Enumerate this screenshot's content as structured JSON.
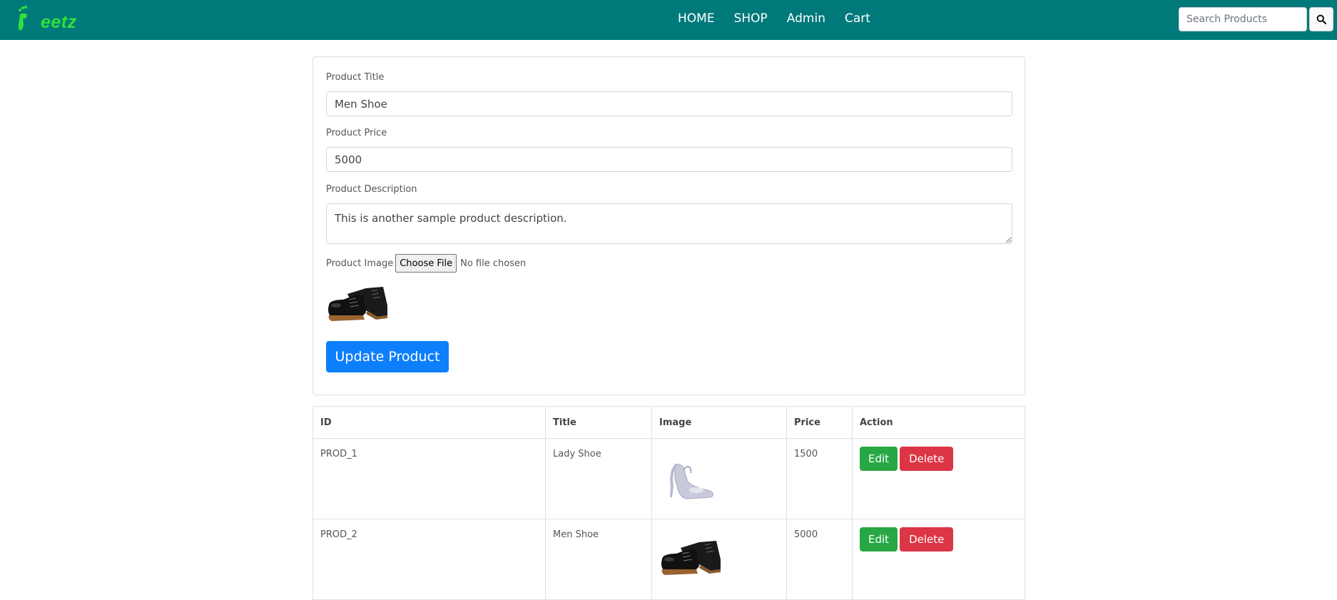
{
  "brand": {
    "name": "eetz",
    "accent": "#2ee23a",
    "nav_bg": "#00797a"
  },
  "nav": {
    "links": [
      {
        "label": "HOME"
      },
      {
        "label": "SHOP"
      },
      {
        "label": "Admin"
      },
      {
        "label": "Cart"
      }
    ],
    "search_placeholder": "Search Products",
    "search_icon": "search-icon"
  },
  "form": {
    "title_label": "Product Title",
    "title_value": "Men Shoe",
    "price_label": "Product Price",
    "price_value": "5000",
    "description_label": "Product Description",
    "description_value": "This is another sample product description.",
    "image_label": "Product Image",
    "file_button": "Choose File",
    "file_status": "No file chosen",
    "preview_image": "men-shoe-image",
    "submit_label": "Update Product"
  },
  "table": {
    "headers": [
      "ID",
      "Title",
      "Image",
      "Price",
      "Action"
    ],
    "rows": [
      {
        "id": "PROD_1",
        "title": "Lady Shoe",
        "image": "lady-shoe-image",
        "price": "1500",
        "edit": "Edit",
        "delete": "Delete"
      },
      {
        "id": "PROD_2",
        "title": "Men Shoe",
        "image": "men-shoe-image",
        "price": "5000",
        "edit": "Edit",
        "delete": "Delete"
      }
    ]
  },
  "colors": {
    "primary": "#0d7ffc",
    "success": "#28a745",
    "danger": "#dc3545"
  }
}
